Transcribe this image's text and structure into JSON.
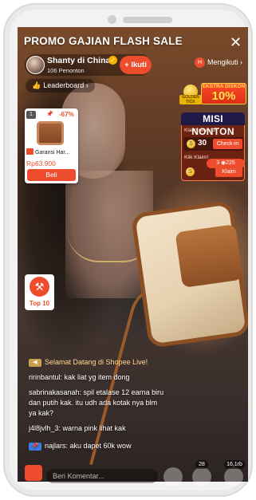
{
  "header": {
    "title": "PROMO GAJIAN FLASH SALE",
    "close_icon": "close-icon"
  },
  "host": {
    "name": "Shanty di China",
    "followers": "106 Penonton",
    "follow_label": "+ Ikuti",
    "following_label": "Mengikuti",
    "following_icon_text": "H"
  },
  "leaderboard": {
    "label": "Leaderboard",
    "chevron": "›"
  },
  "product": {
    "number": "1",
    "discount": "-67%",
    "tag": "Garansi Har...",
    "price": "Rp63.900",
    "buy_label": "Beli"
  },
  "promo": {
    "golden_label": "GOLDEN TICK",
    "extra_label": "EKSTRA DISKON",
    "extra_value": "10%"
  },
  "misi": {
    "title": "MISI NONTON",
    "claim_label": "Klaim reward!",
    "claim_value": "30",
    "checkin_label": "Check-in",
    "klik_label": "Klik Klaim!",
    "qty_text": "3 ◉225",
    "klaim_label": "Klaim"
  },
  "top10": {
    "label": "Top 10"
  },
  "chat": {
    "welcome": "Selamat Datang di Shopee Live!",
    "messages": [
      {
        "text": "ririnbantul: kak liat yg item dong"
      },
      {
        "text": "sabrinakasanah: spil etalase 12 earna biru"
      },
      {
        "text": "dan putih kak. itu udh ada kotak nya blm"
      },
      {
        "text": "ya kak?"
      },
      {
        "text": "j4l8jvlh_3: warna pink lihat kak"
      },
      {
        "text": "najlars: aku dapet 60k wow"
      }
    ]
  },
  "bottom": {
    "comment_placeholder": "Beri Komentar...",
    "like_count": "28",
    "share_count": "16,1rb"
  },
  "colors": {
    "accent": "#ee4d2d",
    "gold": "#f5b400"
  }
}
